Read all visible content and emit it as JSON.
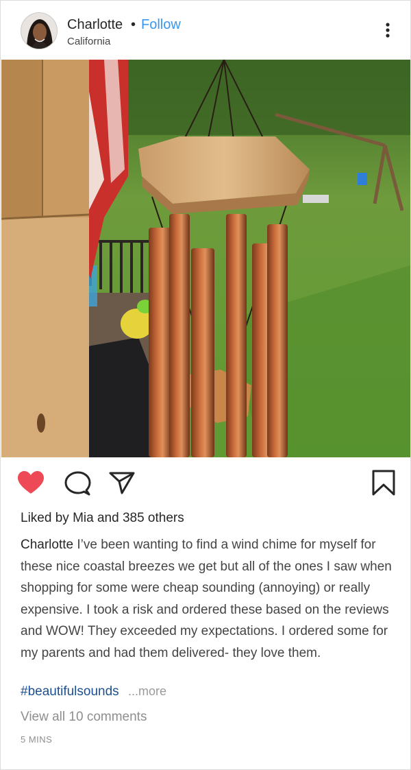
{
  "header": {
    "username": "Charlotte",
    "separator": "•",
    "follow_label": "Follow",
    "location": "California"
  },
  "icons": {
    "avatar": "profile-photo",
    "more": "vertical-dots-icon",
    "like": "heart-icon",
    "comment": "speech-bubble-icon",
    "share": "paper-plane-icon",
    "save": "bookmark-icon"
  },
  "colors": {
    "follow": "#3897f0",
    "heart": "#ed4956",
    "hashtag": "#1c4f8f",
    "muted": "#8e8e8e"
  },
  "post": {
    "liked": true,
    "likes_prefix": "Liked by",
    "liked_by_user": "Mia",
    "likes_joiner": "and",
    "likes_others": "385 others",
    "caption_user": "Charlotte",
    "caption_text": "I’ve been wanting to find a wind chime for myself for these nice coastal breezes we get but all of the ones I saw when shopping for some were cheap sounding (annoying) or really expensive. I took a risk and ordered these based on the reviews and WOW! They exceeded my expectations. I ordered some for my parents and had them delivered- they love them.",
    "hashtag": "#beautifulsounds",
    "more_label": "...more",
    "view_comments": "View all 10 comments",
    "timestamp": "5 MINS"
  }
}
